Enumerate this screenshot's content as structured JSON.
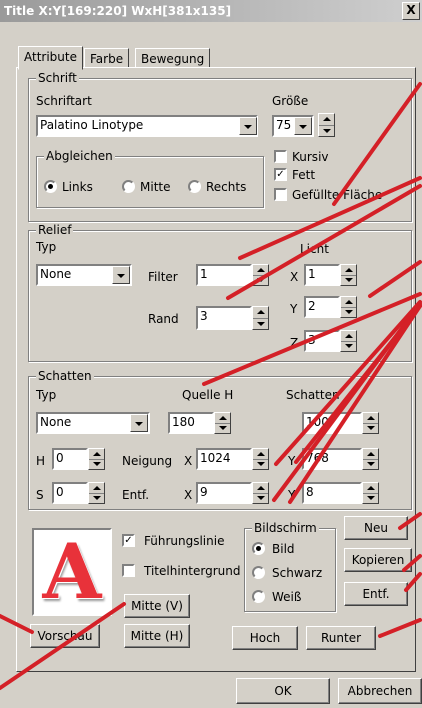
{
  "window": {
    "title": "Title  X:Y[169:220] WxH[381x135]",
    "close_glyph": "X"
  },
  "tabs": [
    {
      "label": "Attribute",
      "active": true
    },
    {
      "label": "Farbe",
      "active": false
    },
    {
      "label": "Bewegung",
      "active": false
    }
  ],
  "schrift": {
    "legend": "Schrift",
    "schriftart_label": "Schriftart",
    "schriftart_value": "Palatino Linotype",
    "groesse_label": "Größe",
    "groesse_value": "75",
    "kursiv_label": "Kursiv",
    "kursiv_checked": false,
    "fett_label": "Fett",
    "fett_checked": true,
    "gefuellt_label": "Gefüllte Fläche",
    "gefuellt_checked": false,
    "abgleichen": {
      "legend": "Abgleichen",
      "options": [
        {
          "label": "Links",
          "selected": true
        },
        {
          "label": "Mitte",
          "selected": false
        },
        {
          "label": "Rechts",
          "selected": false
        }
      ]
    }
  },
  "relief": {
    "legend": "Relief",
    "typ_label": "Typ",
    "typ_value": "None",
    "filter_label": "Filter",
    "filter_value": "1",
    "rand_label": "Rand",
    "rand_value": "3",
    "licht_label": "Licht",
    "x_label": "X",
    "x_value": "1",
    "y_label": "Y",
    "y_value": "2",
    "z_label": "Z",
    "z_value": "3"
  },
  "schatten": {
    "legend": "Schatten",
    "typ_label": "Typ",
    "typ_value": "None",
    "quelle_label": "Quelle H",
    "quelle_value": "180",
    "schatten_label": "Schatten",
    "schatten_value": "100",
    "h_label": "H",
    "h_value": "0",
    "s_label": "S",
    "s_value": "0",
    "neigung_label": "Neigung",
    "neigung_x_label": "X",
    "neigung_x_value": "1024",
    "neigung_y_label": "Y",
    "neigung_y_value": "768",
    "entf_label": "Entf.",
    "entf_x_label": "X",
    "entf_x_value": "9",
    "entf_y_label": "Y",
    "entf_y_value": "8"
  },
  "bottom": {
    "preview_letter": "A",
    "fuehrungslinie_label": "Führungslinie",
    "fuehrungslinie_checked": true,
    "titelhintergrund_label": "Titelhintergrund",
    "titelhintergrund_checked": false,
    "mitte_v": "Mitte (V)",
    "mitte_h": "Mitte (H)",
    "vorschau": "Vorschau",
    "bildschirm": {
      "legend": "Bildschirm",
      "options": [
        {
          "label": "Bild",
          "selected": true
        },
        {
          "label": "Schwarz",
          "selected": false
        },
        {
          "label": "Weiß",
          "selected": false
        }
      ]
    },
    "neu": "Neu",
    "kopieren": "Kopieren",
    "entf": "Entf.",
    "hoch": "Hoch",
    "runter": "Runter"
  },
  "footer": {
    "ok": "OK",
    "abbrechen": "Abbrechen"
  },
  "colors": {
    "annotation_line": "#d42027",
    "dialog_bg": "#d4d0c8",
    "preview_letter": "#e8323a"
  }
}
